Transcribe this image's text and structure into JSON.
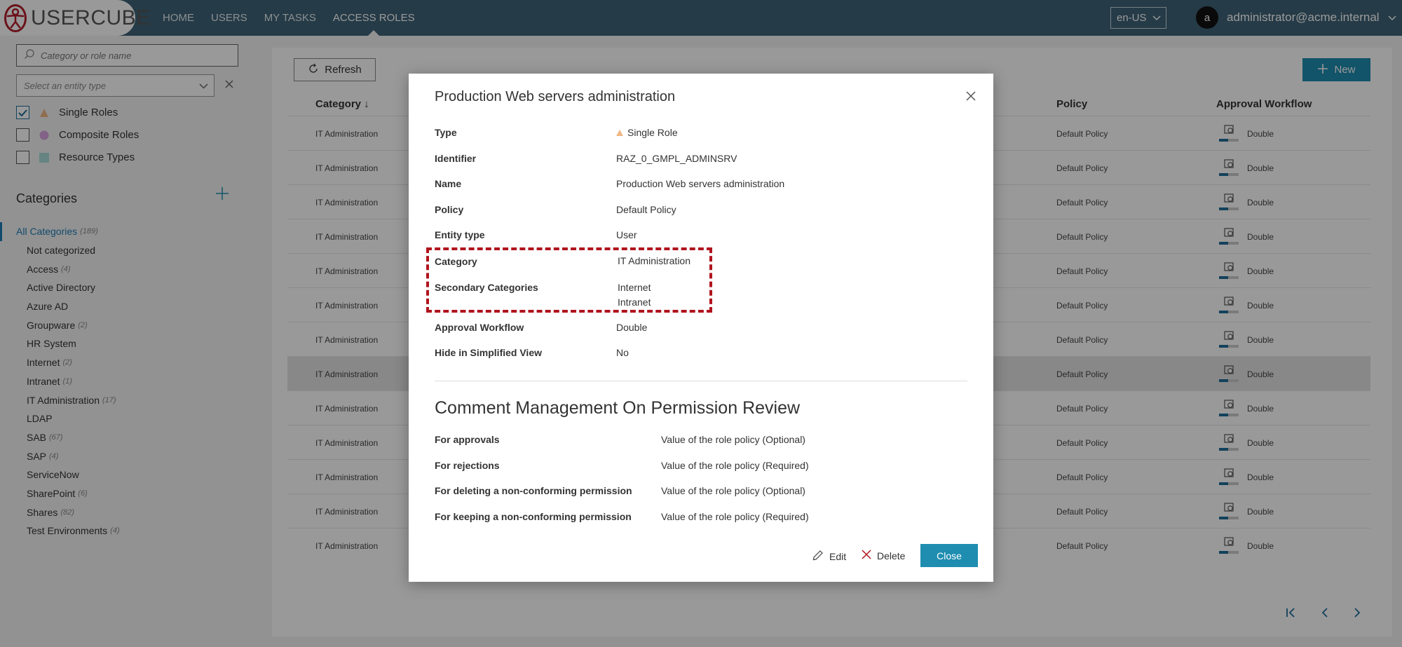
{
  "app": {
    "logo_text": "USERCUBE"
  },
  "nav": [
    {
      "label": "HOME"
    },
    {
      "label": "USERS"
    },
    {
      "label": "MY TASKS"
    },
    {
      "label": "ACCESS ROLES"
    }
  ],
  "header": {
    "language": "en-US",
    "user_initial": "a",
    "user_name": "administrator@acme.internal"
  },
  "sidebar": {
    "search_placeholder": "Category or role name",
    "entity_placeholder": "Select an entity type",
    "filters": [
      {
        "label": "Single Roles",
        "checked": true,
        "color": "#f0b785"
      },
      {
        "label": "Composite Roles",
        "checked": false,
        "color": "#d9a4e0"
      },
      {
        "label": "Resource Types",
        "checked": false,
        "color": "#a9dcd9"
      }
    ],
    "categories_heading": "Categories",
    "categories": [
      {
        "label": "All Categories",
        "count": "(189)"
      },
      {
        "label": "Not categorized",
        "count": ""
      },
      {
        "label": "Access",
        "count": "(4)"
      },
      {
        "label": "Active Directory",
        "count": ""
      },
      {
        "label": "Azure AD",
        "count": ""
      },
      {
        "label": "Groupware",
        "count": "(2)"
      },
      {
        "label": "HR System",
        "count": ""
      },
      {
        "label": "Internet",
        "count": "(2)"
      },
      {
        "label": "Intranet",
        "count": "(1)"
      },
      {
        "label": "IT Administration",
        "count": "(17)"
      },
      {
        "label": "LDAP",
        "count": ""
      },
      {
        "label": "SAB",
        "count": "(67)"
      },
      {
        "label": "SAP",
        "count": "(4)"
      },
      {
        "label": "ServiceNow",
        "count": ""
      },
      {
        "label": "SharePoint",
        "count": "(6)"
      },
      {
        "label": "Shares",
        "count": "(82)"
      },
      {
        "label": "Test Environments",
        "count": "(4)"
      }
    ]
  },
  "toolbar": {
    "refresh_label": "Refresh",
    "new_label": "New"
  },
  "table": {
    "headers": {
      "category": "Category ↓",
      "policy": "Policy",
      "workflow": "Approval Workflow"
    },
    "rows": [
      {
        "category": "IT Administration",
        "policy": "Default Policy",
        "workflow": "Double"
      },
      {
        "category": "IT Administration",
        "policy": "Default Policy",
        "workflow": "Double"
      },
      {
        "category": "IT Administration",
        "policy": "Default Policy",
        "workflow": "Double"
      },
      {
        "category": "IT Administration",
        "policy": "Default Policy",
        "workflow": "Double"
      },
      {
        "category": "IT Administration",
        "policy": "Default Policy",
        "workflow": "Double"
      },
      {
        "category": "IT Administration",
        "policy": "Default Policy",
        "workflow": "Double"
      },
      {
        "category": "IT Administration",
        "policy": "Default Policy",
        "workflow": "Double"
      },
      {
        "category": "IT Administration",
        "policy": "Default Policy",
        "workflow": "Double"
      },
      {
        "category": "IT Administration",
        "policy": "Default Policy",
        "workflow": "Double"
      },
      {
        "category": "IT Administration",
        "policy": "Default Policy",
        "workflow": "Double"
      },
      {
        "category": "IT Administration",
        "policy": "Default Policy",
        "workflow": "Double"
      },
      {
        "category": "IT Administration",
        "policy": "Default Policy",
        "workflow": "Double"
      },
      {
        "category": "IT Administration",
        "policy": "Default Policy",
        "workflow": "Double"
      }
    ]
  },
  "modal": {
    "title": "Production Web servers administration",
    "fields": {
      "type_label": "Type",
      "type_value": "Single Role",
      "identifier_label": "Identifier",
      "identifier_value": "RAZ_0_GMPL_ADMINSRV",
      "name_label": "Name",
      "name_value": "Production Web servers administration",
      "policy_label": "Policy",
      "policy_value": "Default Policy",
      "entity_label": "Entity type",
      "entity_value": "User",
      "category_label": "Category",
      "category_value": "IT Administration",
      "secondary_label": "Secondary Categories",
      "secondary_value_1": "Internet",
      "secondary_value_2": "Intranet",
      "workflow_label": "Approval Workflow",
      "workflow_value": "Double",
      "hide_label": "Hide in Simplified View",
      "hide_value": "No"
    },
    "comment_section": {
      "title": "Comment Management On Permission Review",
      "items": [
        {
          "label": "For approvals",
          "value": "Value of the role policy (Optional)"
        },
        {
          "label": "For rejections",
          "value": "Value of the role policy (Required)"
        },
        {
          "label": "For deleting a non-conforming permission",
          "value": "Value of the role policy (Optional)"
        },
        {
          "label": "For keeping a non-conforming permission",
          "value": "Value of the role policy (Required)"
        }
      ]
    },
    "actions": {
      "edit": "Edit",
      "delete": "Delete",
      "close": "Close"
    }
  }
}
